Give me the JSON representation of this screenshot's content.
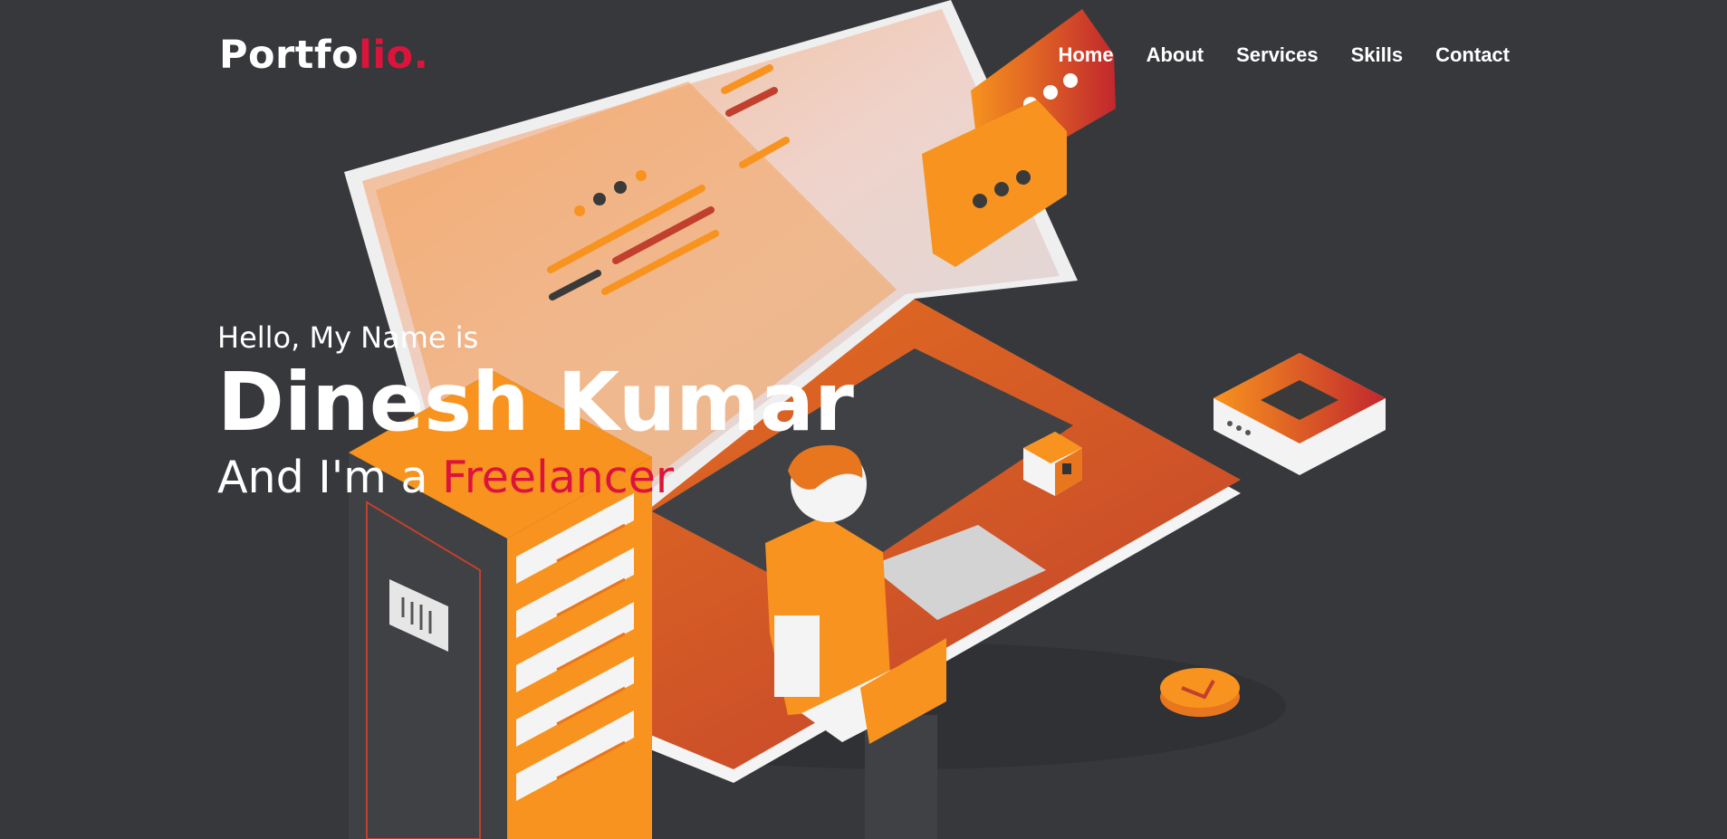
{
  "brand": {
    "text": "Portfo",
    "accent_text": "lio."
  },
  "nav": {
    "items": [
      {
        "label": "Home"
      },
      {
        "label": "About"
      },
      {
        "label": "Services"
      },
      {
        "label": "Skills"
      },
      {
        "label": "Contact"
      }
    ]
  },
  "hero": {
    "greeting": "Hello, My Name is",
    "name": "Dinesh Kumar",
    "role_prefix": "And I'm a ",
    "role_typed": "Freelancer"
  },
  "theme": {
    "background": "#36383c",
    "accent": "#dc143c",
    "illustration_orange": "#f7931e",
    "illustration_red": "#c1272d"
  },
  "illustration": {
    "icons": [
      "laptop-icon",
      "server-rack-icon",
      "chat-bubble-icon",
      "person-icon",
      "router-icon",
      "coin-icon",
      "cube-icon"
    ]
  }
}
